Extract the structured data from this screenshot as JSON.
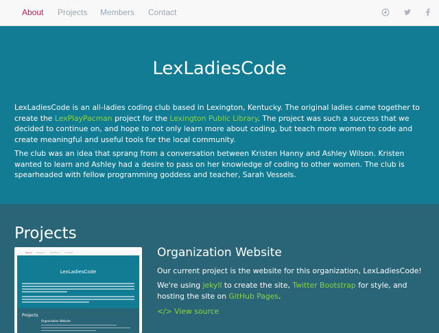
{
  "navbar": {
    "links": [
      {
        "label": "About"
      },
      {
        "label": "Projects"
      },
      {
        "label": "Members"
      },
      {
        "label": "Contact"
      }
    ],
    "icons": [
      "github-icon",
      "twitter-icon",
      "facebook-icon"
    ]
  },
  "hero": {
    "title": "LexLadiesCode",
    "p1_a": "LexLadiesCode is an all-ladies coding club based in Lexington, Kentucky. The original ladies came together to create the",
    "p1_link1": "LexPlayPacman",
    "p1_b": "project for the",
    "p1_link2": "Lexington Public Library",
    "p1_c": ". The project was such a success that we decided to continue on, and hope to not only learn more about coding, but teach more women to code and create meaningful and useful tools for the local community.",
    "p2": "The club was an idea that sprang from a conversation between Kristen Hanny and Ashley Wilson. Kristen wanted to learn and Ashley had a desire to pass on her knowledge of coding to other women. The club is spearheaded with fellow programming goddess and teacher, Sarah Vessels."
  },
  "projects": {
    "heading": "Projects",
    "project": {
      "title": "Organization Website",
      "p1": "Our current project is the website for this organization, LexLadiesCode!",
      "p2_a": "We're using",
      "p2_link1": "jekyll",
      "p2_b": "to create the site,",
      "p2_link2": "Twitter Bootstrap",
      "p2_c": "for style, and hosting the site on",
      "p2_link3": "GitHub Pages",
      "p2_d": ".",
      "view_source": "</> View source"
    }
  },
  "thumbnail": {
    "nav": [
      "About",
      "Projects",
      "Members",
      "Contact"
    ],
    "title": "LexLadiesCode",
    "projects": "Projects",
    "org": "Organization Website"
  },
  "colors": {
    "accent_active": "#c2185b",
    "link_green": "#8cd43d",
    "hero_bg": "#127c94",
    "section_bg": "#2a6577"
  }
}
